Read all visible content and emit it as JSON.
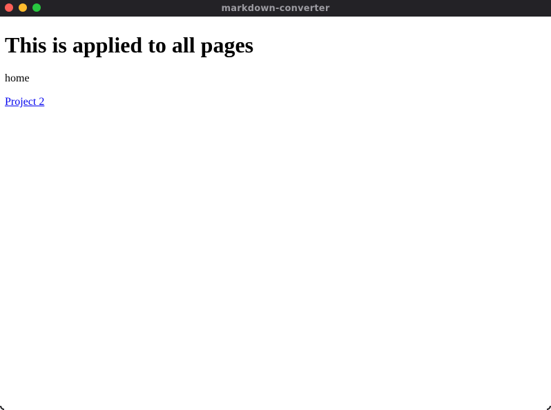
{
  "window": {
    "title": "markdown-converter",
    "controls": [
      {
        "name": "close-button",
        "color": "#fe5f57"
      },
      {
        "name": "minimize-button",
        "color": "#febc2e"
      },
      {
        "name": "maximize-button",
        "color": "#28c840"
      }
    ]
  },
  "page": {
    "heading": "This is applied to all pages",
    "text": "home",
    "link": "Project 2"
  },
  "colors": {
    "titlebar": "#232226",
    "title_text": "#9c9ba1",
    "link": "#0000ee",
    "background": "#ffffff"
  }
}
